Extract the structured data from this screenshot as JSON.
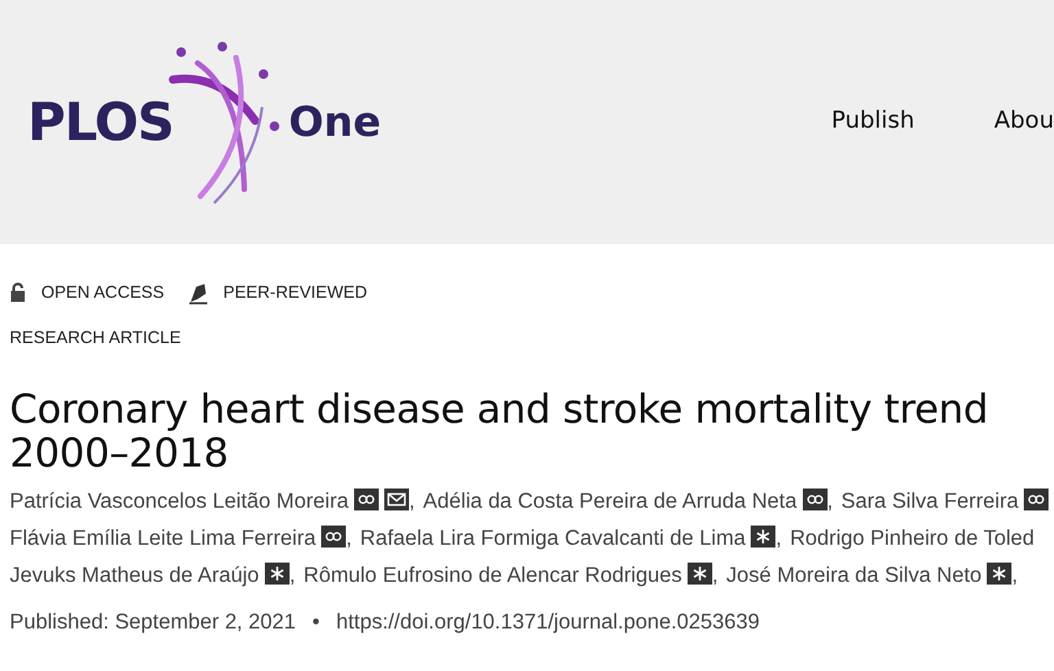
{
  "header": {
    "logo": {
      "wordmark": "PLOS",
      "journal": "One"
    },
    "nav": [
      {
        "label": "Publish"
      },
      {
        "label": "Abou"
      }
    ]
  },
  "tags": [
    {
      "kind": "open",
      "label": "OPEN ACCESS"
    },
    {
      "kind": "peer",
      "label": "PEER-REVIEWED"
    }
  ],
  "article_type": "RESEARCH ARTICLE",
  "title_lines": [
    "Coronary heart disease and stroke mortality trend",
    "2000–2018"
  ],
  "author_lines": [
    [
      {
        "name": "Patrícia Vasconcelos Leitão Moreira",
        "badges": [
          {
            "kind": "contrib"
          },
          {
            "kind": "email"
          }
        ],
        "separator": ","
      },
      {
        "name": "Adélia da Costa Pereira de Arruda Neta",
        "badges": [
          {
            "kind": "contrib"
          }
        ],
        "separator": ","
      },
      {
        "name": "Sara Silva Ferreira",
        "badges": [
          {
            "kind": "contrib"
          }
        ]
      }
    ],
    [
      {
        "name": "Flávia Emília Leite Lima Ferreira",
        "badges": [
          {
            "kind": "contrib"
          }
        ],
        "separator": ","
      },
      {
        "name": "Rafaela Lira Formiga Cavalcanti de Lima",
        "badges": [
          {
            "kind": "star"
          }
        ],
        "separator": ","
      },
      {
        "name": "Rodrigo Pinheiro de Toled"
      }
    ],
    [
      {
        "name": "Jevuks Matheus de Araújo",
        "badges": [
          {
            "kind": "star"
          }
        ],
        "separator": ","
      },
      {
        "name": "Rômulo Eufrosino de Alencar Rodrigues",
        "badges": [
          {
            "kind": "star"
          }
        ],
        "separator": ","
      },
      {
        "name": "José Moreira da Silva Neto",
        "badges": [
          {
            "kind": "star"
          }
        ],
        "separator": ","
      }
    ]
  ],
  "published": "Published: September 2, 2021",
  "bullet": "•",
  "doi": "https://doi.org/10.1371/journal.pone.0253639"
}
